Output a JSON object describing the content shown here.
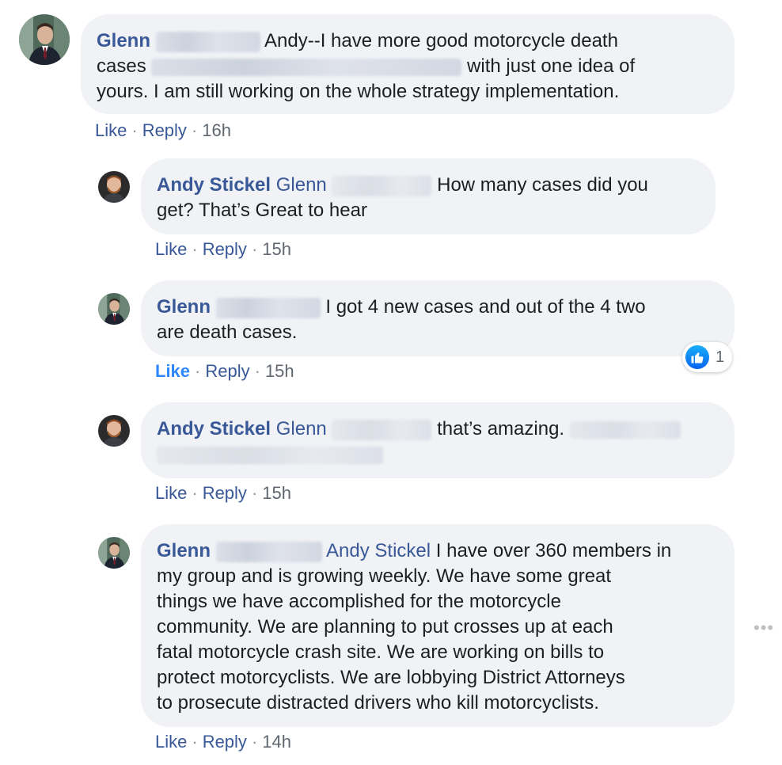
{
  "comments": [
    {
      "author": "Glenn",
      "text_a": "Andy--I have more good motorcycle death",
      "text_b": "cases",
      "text_c": "with just one idea of",
      "text_d": "yours. I am still working on the whole strategy implementation.",
      "like": "Like",
      "reply": "Reply",
      "time": "16h"
    },
    {
      "author": "Andy Stickel",
      "mention": "Glenn",
      "text_a": "How many cases did you",
      "text_b": "get? That’s Great to hear",
      "like": "Like",
      "reply": "Reply",
      "time": "15h"
    },
    {
      "author": "Glenn",
      "text_a": "I got 4 new cases and out of the 4 two",
      "text_b": "are death cases.",
      "like": "Like",
      "reply": "Reply",
      "time": "15h",
      "reaction_count": "1"
    },
    {
      "author": "Andy Stickel",
      "mention": "Glenn",
      "text_a": "that’s amazing.",
      "like": "Like",
      "reply": "Reply",
      "time": "15h"
    },
    {
      "author": "Glenn",
      "mention": "Andy Stickel",
      "text_a": "I have over 360 members in",
      "text_b": "my group and is growing weekly. We have some great",
      "text_c": "things we have accomplished for the motorcycle",
      "text_d": "community. We are planning to put crosses up at each",
      "text_e": "fatal motorcycle crash site. We are working on bills to",
      "text_f": "protect motorcyclists. We are lobbying District Attorneys",
      "text_g": "to prosecute distracted drivers who kill motorcyclists.",
      "like": "Like",
      "reply": "Reply",
      "time": "14h"
    }
  ],
  "more_menu": "•••",
  "colors": {
    "bubble": "#f0f2f5",
    "name": "#385898",
    "like_active": "#2d88ff",
    "meta": "#606770"
  }
}
